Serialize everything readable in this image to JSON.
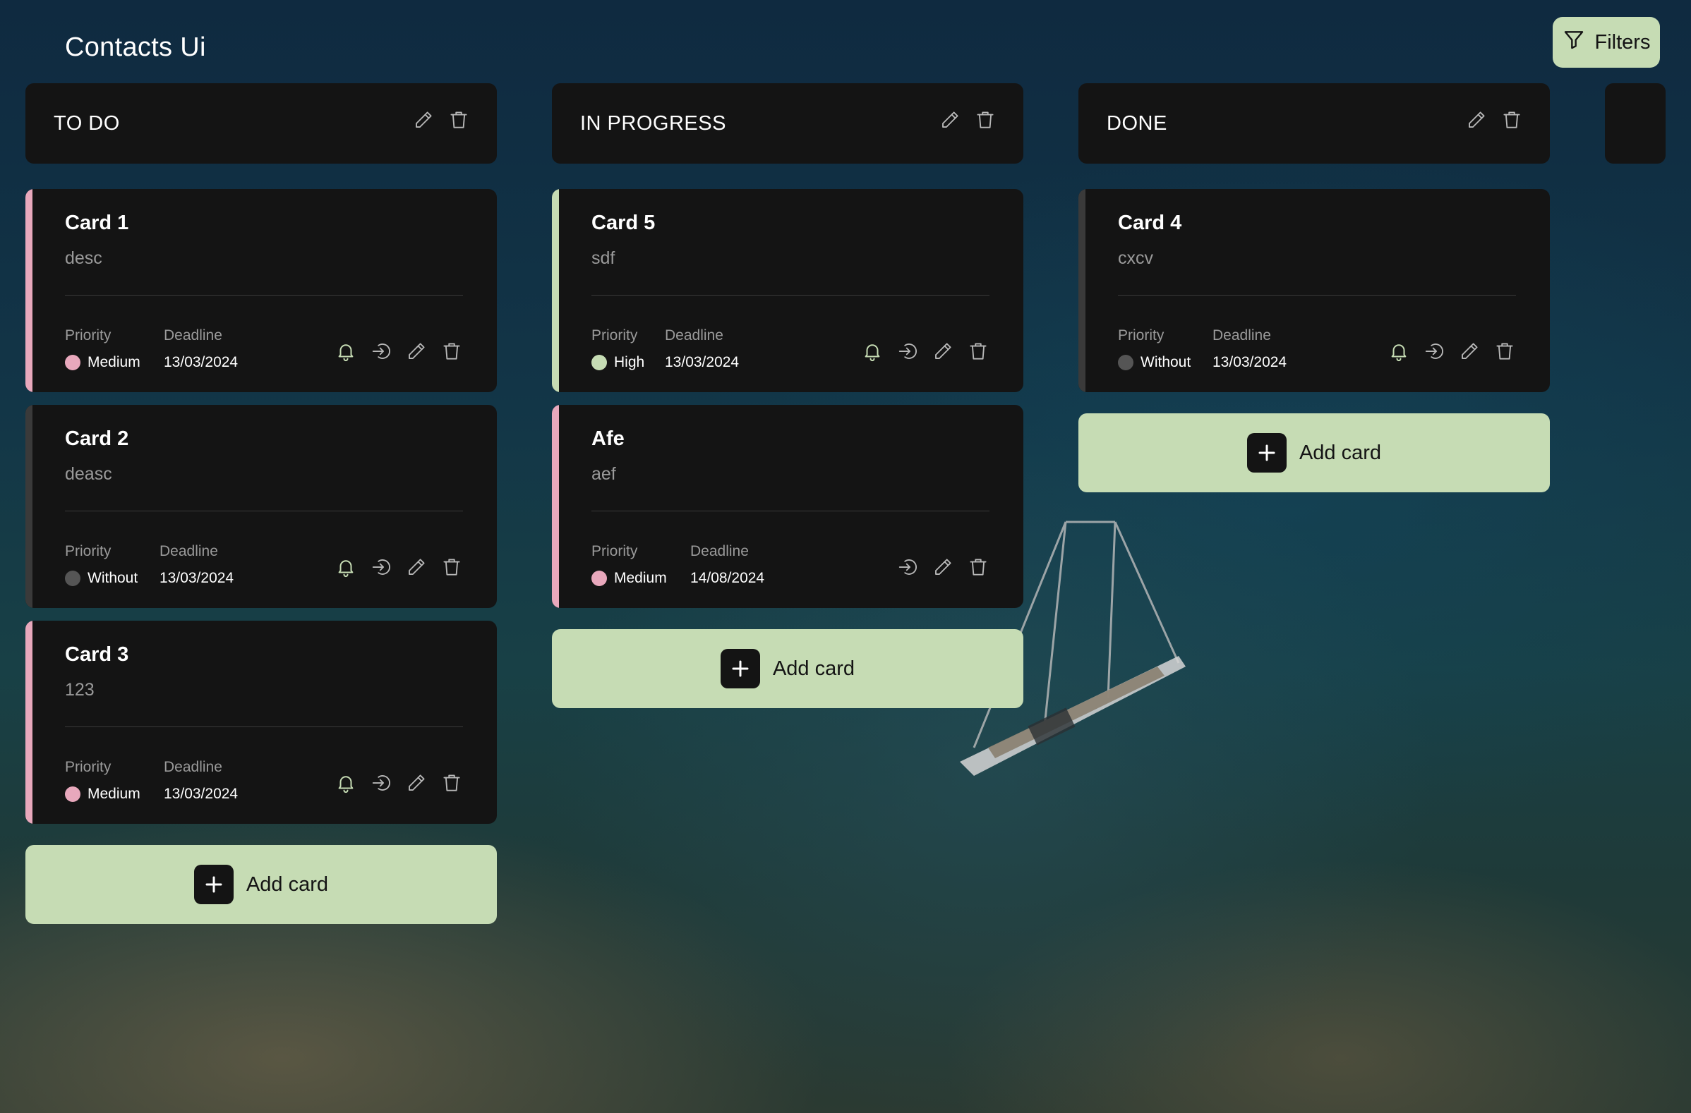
{
  "app": {
    "title": "Contacts Ui"
  },
  "toolbar": {
    "filters_label": "Filters"
  },
  "colors": {
    "card_bg": "#141414",
    "accent": "#c6dcb4",
    "priority_high": "#c6dcb4",
    "priority_medium": "#e8a8bc",
    "priority_without": "#555555"
  },
  "labels": {
    "priority": "Priority",
    "deadline": "Deadline",
    "add_card": "Add card"
  },
  "columns": [
    {
      "title": "TO DO",
      "cards": [
        {
          "title": "Card 1",
          "desc": "desc",
          "priority": "Medium",
          "deadline": "13/03/2024",
          "has_bell": true
        },
        {
          "title": "Card 2",
          "desc": "deasc",
          "priority": "Without",
          "deadline": "13/03/2024",
          "has_bell": true
        },
        {
          "title": "Card 3",
          "desc": "123",
          "priority": "Medium",
          "deadline": "13/03/2024",
          "has_bell": true
        }
      ]
    },
    {
      "title": "IN PROGRESS",
      "cards": [
        {
          "title": "Card 5",
          "desc": "sdf",
          "priority": "High",
          "deadline": "13/03/2024",
          "has_bell": true
        },
        {
          "title": "Afe",
          "desc": "aef",
          "priority": "Medium",
          "deadline": "14/08/2024",
          "has_bell": false
        }
      ]
    },
    {
      "title": "DONE",
      "cards": [
        {
          "title": "Card 4",
          "desc": "cxcv",
          "priority": "Without",
          "deadline": "13/03/2024",
          "has_bell": true
        }
      ]
    }
  ],
  "icons": [
    "filter-icon",
    "pencil-icon",
    "trash-icon",
    "bell-icon",
    "move-icon",
    "plus-icon"
  ]
}
